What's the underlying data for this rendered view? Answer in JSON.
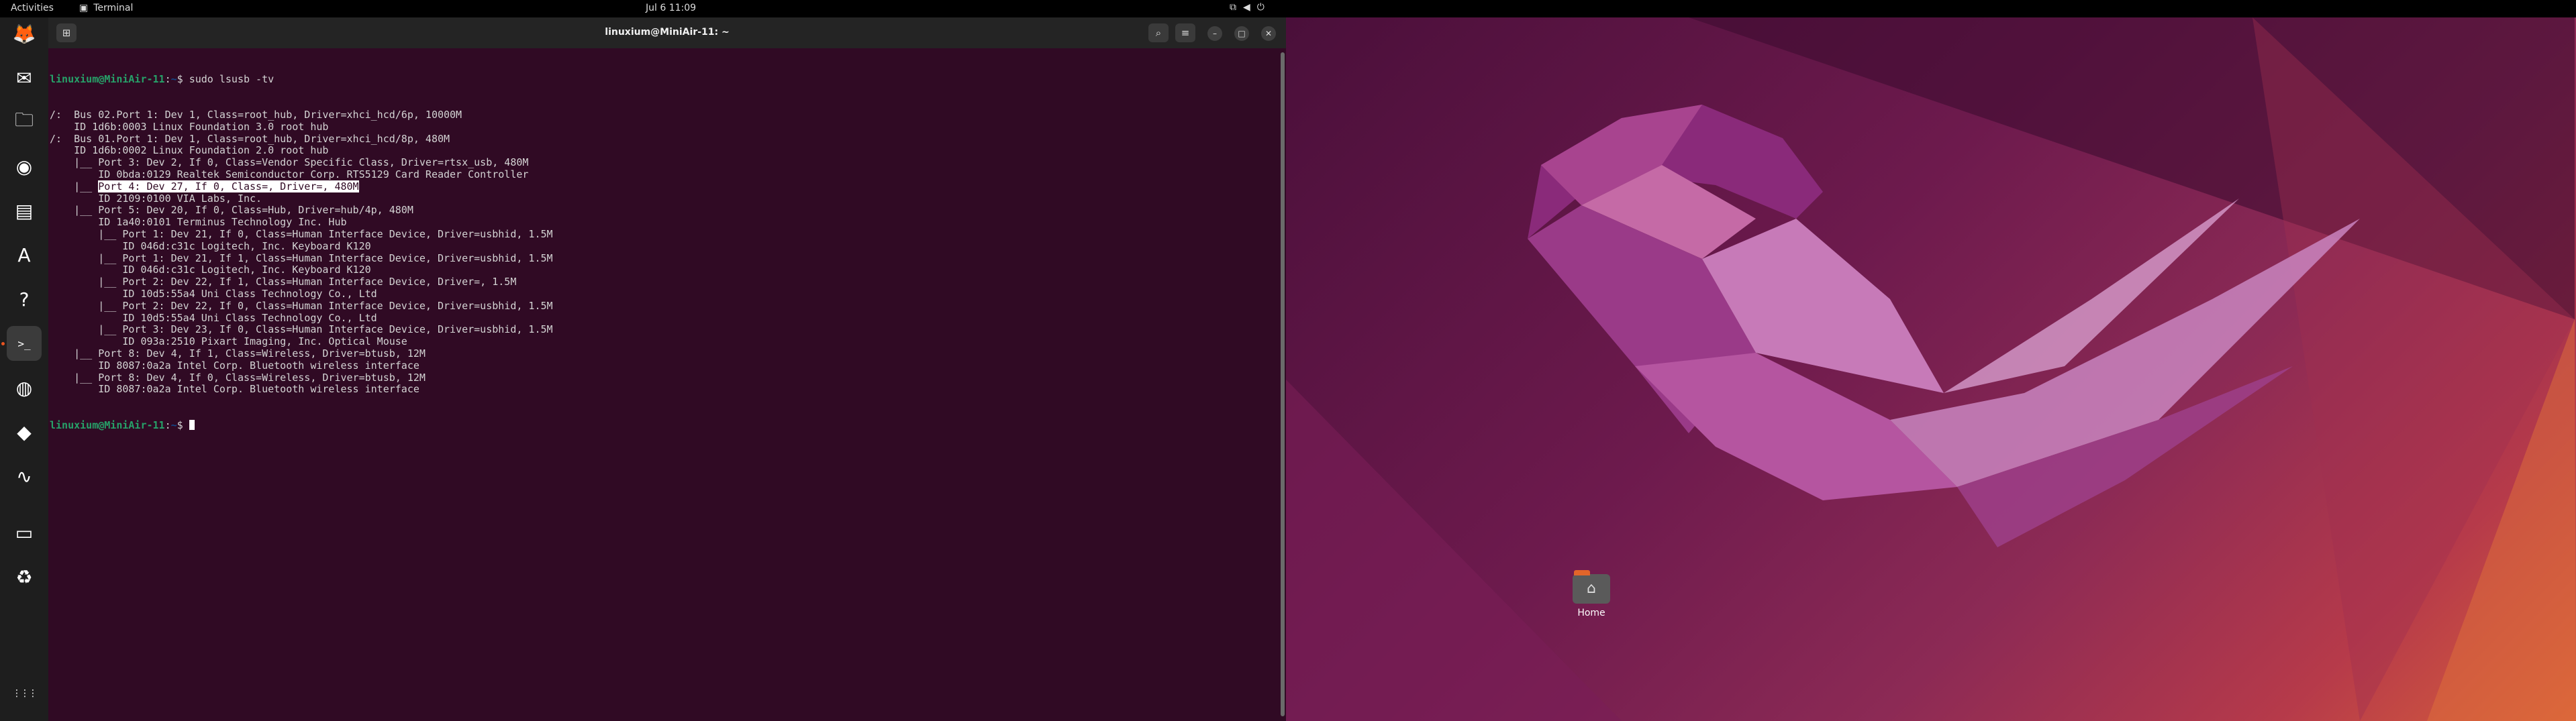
{
  "topbar": {
    "activities": "Activities",
    "app_name": "Terminal",
    "clock": "Jul 6  11:09"
  },
  "dock": {
    "items": [
      {
        "name": "firefox-icon",
        "glyph": "🦊"
      },
      {
        "name": "thunderbird-icon",
        "glyph": "✉"
      },
      {
        "name": "files-icon",
        "glyph": "🗀"
      },
      {
        "name": "rhythmbox-icon",
        "glyph": "◉"
      },
      {
        "name": "writer-icon",
        "glyph": "▤"
      },
      {
        "name": "app-center-icon",
        "glyph": "A"
      },
      {
        "name": "help-icon",
        "glyph": "?"
      },
      {
        "name": "terminal-icon",
        "glyph": ">_"
      },
      {
        "name": "chrome-icon",
        "glyph": "◍"
      },
      {
        "name": "kodi-icon",
        "glyph": "◆"
      },
      {
        "name": "system-monitor-icon",
        "glyph": "∿"
      },
      {
        "name": "disk-icon",
        "glyph": "▭"
      },
      {
        "name": "trash-icon",
        "glyph": "♻"
      },
      {
        "name": "show-apps-icon",
        "glyph": "⋮⋮⋮"
      }
    ]
  },
  "terminal": {
    "title": "linuxium@MiniAir-11: ~",
    "prompt_user": "linuxium@MiniAir-11",
    "prompt_path": "~",
    "command": "sudo lsusb -tv",
    "lines": [
      "/:  Bus 02.Port 1: Dev 1, Class=root_hub, Driver=xhci_hcd/6p, 10000M",
      "    ID 1d6b:0003 Linux Foundation 3.0 root hub",
      "/:  Bus 01.Port 1: Dev 1, Class=root_hub, Driver=xhci_hcd/8p, 480M",
      "    ID 1d6b:0002 Linux Foundation 2.0 root hub",
      "    |__ Port 3: Dev 2, If 0, Class=Vendor Specific Class, Driver=rtsx_usb, 480M",
      "        ID 0bda:0129 Realtek Semiconductor Corp. RTS5129 Card Reader Controller",
      "    |__ ",
      "        ID 2109:0100 VIA Labs, Inc.",
      "    |__ Port 5: Dev 20, If 0, Class=Hub, Driver=hub/4p, 480M",
      "        ID 1a40:0101 Terminus Technology Inc. Hub",
      "        |__ Port 1: Dev 21, If 0, Class=Human Interface Device, Driver=usbhid, 1.5M",
      "            ID 046d:c31c Logitech, Inc. Keyboard K120",
      "        |__ Port 1: Dev 21, If 1, Class=Human Interface Device, Driver=usbhid, 1.5M",
      "            ID 046d:c31c Logitech, Inc. Keyboard K120",
      "        |__ Port 2: Dev 22, If 1, Class=Human Interface Device, Driver=, 1.5M",
      "            ID 10d5:55a4 Uni Class Technology Co., Ltd",
      "        |__ Port 2: Dev 22, If 0, Class=Human Interface Device, Driver=usbhid, 1.5M",
      "            ID 10d5:55a4 Uni Class Technology Co., Ltd",
      "        |__ Port 3: Dev 23, If 0, Class=Human Interface Device, Driver=usbhid, 1.5M",
      "            ID 093a:2510 Pixart Imaging, Inc. Optical Mouse",
      "    |__ Port 8: Dev 4, If 1, Class=Wireless, Driver=btusb, 12M",
      "        ID 8087:0a2a Intel Corp. Bluetooth wireless interface",
      "    |__ Port 8: Dev 4, If 0, Class=Wireless, Driver=btusb, 12M",
      "        ID 8087:0a2a Intel Corp. Bluetooth wireless interface"
    ],
    "highlighted": "Port 4: Dev 27, If 0, Class=, Driver=, 480M",
    "prompt_end": " $ "
  },
  "desktop": {
    "home_label": "Home"
  },
  "colors": {
    "terminal_bg": "#300a24",
    "prompt_user": "#26a269",
    "prompt_path": "#12488b",
    "accent": "#e95420"
  }
}
